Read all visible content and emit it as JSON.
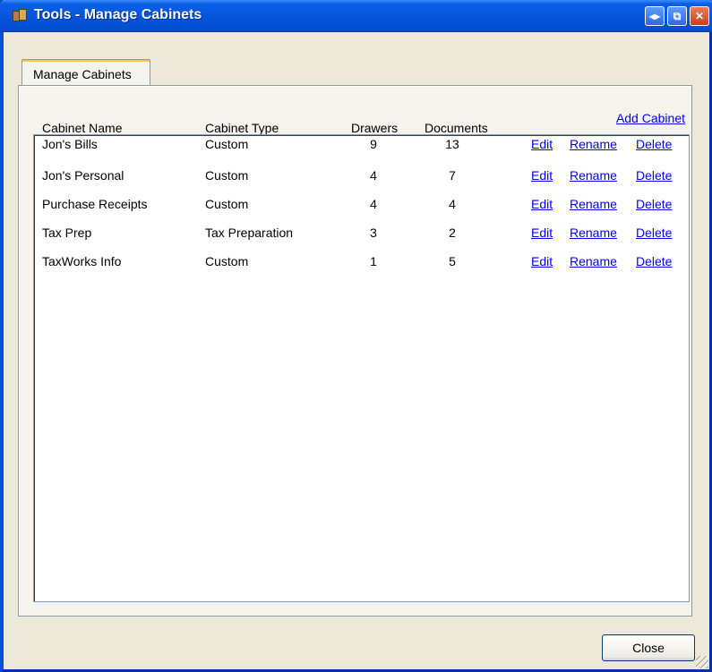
{
  "window": {
    "title": "Tools - Manage Cabinets"
  },
  "tabs": [
    {
      "label": "Manage Cabinets"
    }
  ],
  "columns": {
    "name": "Cabinet Name",
    "type": "Cabinet Type",
    "drawers": "Drawers",
    "documents": "Documents"
  },
  "add_cabinet_label": "Add Cabinet",
  "row_actions": {
    "edit": "Edit",
    "rename": "Rename",
    "delete": "Delete"
  },
  "cabinets": [
    {
      "name": "Jon's Bills",
      "type": "Custom",
      "drawers": "9",
      "documents": "13"
    },
    {
      "name": "Jon's Personal",
      "type": "Custom",
      "drawers": "4",
      "documents": "7"
    },
    {
      "name": "Purchase Receipts",
      "type": "Custom",
      "drawers": "4",
      "documents": "4"
    },
    {
      "name": "Tax Prep",
      "type": "Tax Preparation",
      "drawers": "3",
      "documents": "2"
    },
    {
      "name": "TaxWorks Info",
      "type": "Custom",
      "drawers": "1",
      "documents": "5"
    }
  ],
  "footer": {
    "close_label": "Close"
  },
  "colors": {
    "title_bar": "#0654dc",
    "dialog_bg": "#ece9d8",
    "link": "#0000ee"
  }
}
